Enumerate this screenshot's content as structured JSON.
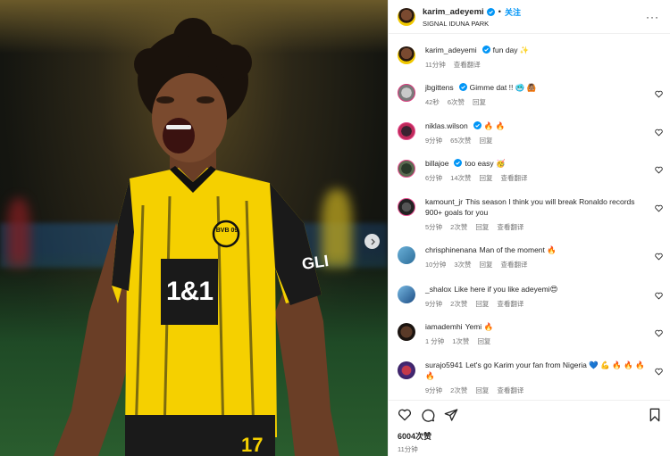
{
  "post": {
    "username": "karim_adeyemi",
    "follow_label": "关注",
    "dot": "•",
    "location": "SIGNAL IDUNA PARK",
    "more": "···"
  },
  "photo": {
    "sponsor": "1&1",
    "club_badge": "BVB 09",
    "sleeve": "GLI",
    "number": "17"
  },
  "caption": {
    "username": "karim_adeyemi",
    "text": "fun day ✨",
    "time": "11分钟",
    "translate": "查看翻译"
  },
  "comments": [
    {
      "user": "jbgittens",
      "verified": true,
      "text": "Gimme dat !! 🥶 🙆🏽",
      "time": "42秒",
      "likes": "6次赞",
      "reply": "回复",
      "translate": ""
    },
    {
      "user": "niklas.wilson",
      "verified": true,
      "text": "🔥 🔥",
      "time": "9分钟",
      "likes": "65次赞",
      "reply": "回复",
      "translate": ""
    },
    {
      "user": "billajoe",
      "verified": true,
      "text": "too easy 🥳",
      "time": "6分钟",
      "likes": "14次赞",
      "reply": "回复",
      "translate": "查看翻译"
    },
    {
      "user": "kamount_jr",
      "verified": false,
      "text": "This season I think you will break Ronaldo records 900+ goals for you",
      "time": "5分钟",
      "likes": "2次赞",
      "reply": "回复",
      "translate": "查看翻译"
    },
    {
      "user": "chrisphinenana",
      "verified": false,
      "text": "Man of the moment 🔥",
      "time": "10分钟",
      "likes": "3次赞",
      "reply": "回复",
      "translate": "查看翻译"
    },
    {
      "user": "_shalox",
      "verified": false,
      "text": "Like here if you like adeyemi😍",
      "time": "9分钟",
      "likes": "2次赞",
      "reply": "回复",
      "translate": "查看翻译"
    },
    {
      "user": "iamademhi",
      "verified": false,
      "text": "Yemi 🔥",
      "time": "1 分钟",
      "likes": "1次赞",
      "reply": "回复",
      "translate": ""
    },
    {
      "user": "surajo5941",
      "verified": false,
      "text": "Let's go Karim your fan from Nigeria 💙 💪 🔥 🔥 🔥 🔥",
      "time": "9分钟",
      "likes": "2次赞",
      "reply": "回复",
      "translate": "查看翻译"
    }
  ],
  "footer": {
    "likes": "6004次赞",
    "posted": "11分钟"
  },
  "colors": {
    "accent": "#0095f6",
    "jersey_yellow": "#f5d000",
    "story_ring": "#e44c8d"
  }
}
